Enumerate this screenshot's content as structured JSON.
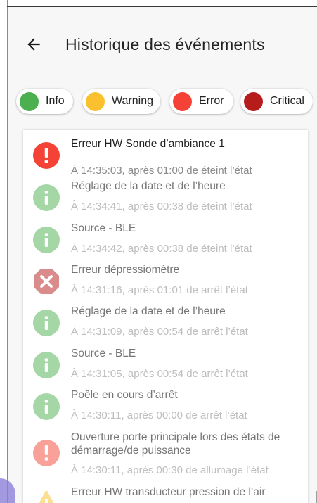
{
  "header": {
    "title": "Historique des événements",
    "back_icon": "arrow-left-icon"
  },
  "filters": [
    {
      "label": "Info",
      "color": "#4caf50"
    },
    {
      "label": "Warning",
      "color": "#fbc02d"
    },
    {
      "label": "Error",
      "color": "#f44336"
    },
    {
      "label": "Critical",
      "color": "#b71c1c"
    }
  ],
  "events": [
    {
      "title": "Erreur HW Sonde d’ambiance 1",
      "time": "À 14:35:03, après 01:00 de éteint l’état",
      "level": "error",
      "icon": "exclamation-icon",
      "faded": false
    },
    {
      "title": "Réglage de la date et de l’heure",
      "time": "À 14:34:41, après 00:38 de éteint l’état",
      "level": "info",
      "icon": "info-icon",
      "faded": true
    },
    {
      "title": "Source - BLE",
      "time": "À 14:34:42, après 00:38 de éteint l’état",
      "level": "info",
      "icon": "info-icon",
      "faded": true
    },
    {
      "title": "Erreur dépressiomètre",
      "time": "À 14:31:16, après 01:01 de arrêt l’état",
      "level": "critical",
      "icon": "close-icon",
      "faded": true
    },
    {
      "title": "Réglage de la date et de l’heure",
      "time": "À 14:31:09, après 00:54 de arrêt l’état",
      "level": "info",
      "icon": "info-icon",
      "faded": true
    },
    {
      "title": "Source - BLE",
      "time": "À 14:31:05, après 00:54 de arrêt l’état",
      "level": "info",
      "icon": "info-icon",
      "faded": true
    },
    {
      "title": "Poêle en cours d’arrêt",
      "time": "À 14:30:11, après 00:00 de arrêt l’état",
      "level": "info",
      "icon": "info-icon",
      "faded": true
    },
    {
      "title": "Ouverture porte principale lors des états de démarrage/de puissance",
      "time": "À 14:30:11, après 00:30 de allumage l’état",
      "level": "error",
      "icon": "exclamation-icon",
      "faded": true
    },
    {
      "title": "Erreur HW transducteur pression de l’air",
      "time": "",
      "level": "warning",
      "icon": "warning-icon",
      "faded": true
    }
  ]
}
